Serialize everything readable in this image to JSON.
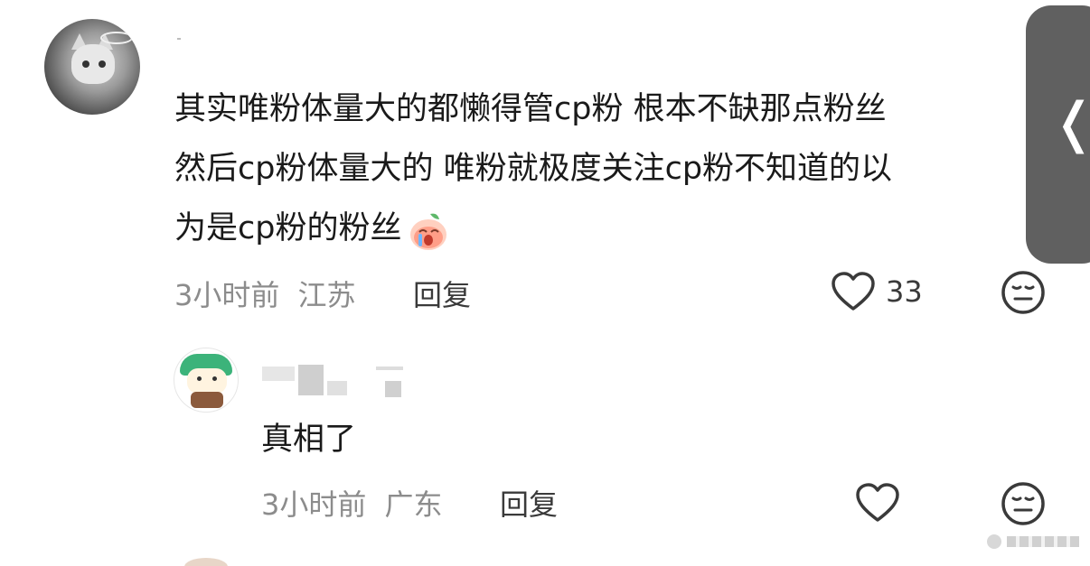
{
  "comments": [
    {
      "lines": [
        "其实唯粉体量大的都懒得管cp粉 根本不缺那点粉丝",
        "然后cp粉体量大的 唯粉就极度关注cp粉不知道的以",
        "为是cp粉的粉丝"
      ],
      "time": "3小时前",
      "location": "江苏",
      "reply_label": "回复",
      "likes": "33"
    },
    {
      "lines": [
        "真相了"
      ],
      "time": "3小时前",
      "location": "广东",
      "reply_label": "回复",
      "likes": ""
    }
  ],
  "icons": {
    "like": "heart-outline-icon",
    "dislike": "neutral-face-icon",
    "side_tab": "chevron-left-icon",
    "emoji": "peach-crying-emoji"
  },
  "colors": {
    "text": "#1a1a1a",
    "meta": "#8c8c8c",
    "icon": "#3a3a3a",
    "side_tab": "#606060"
  }
}
